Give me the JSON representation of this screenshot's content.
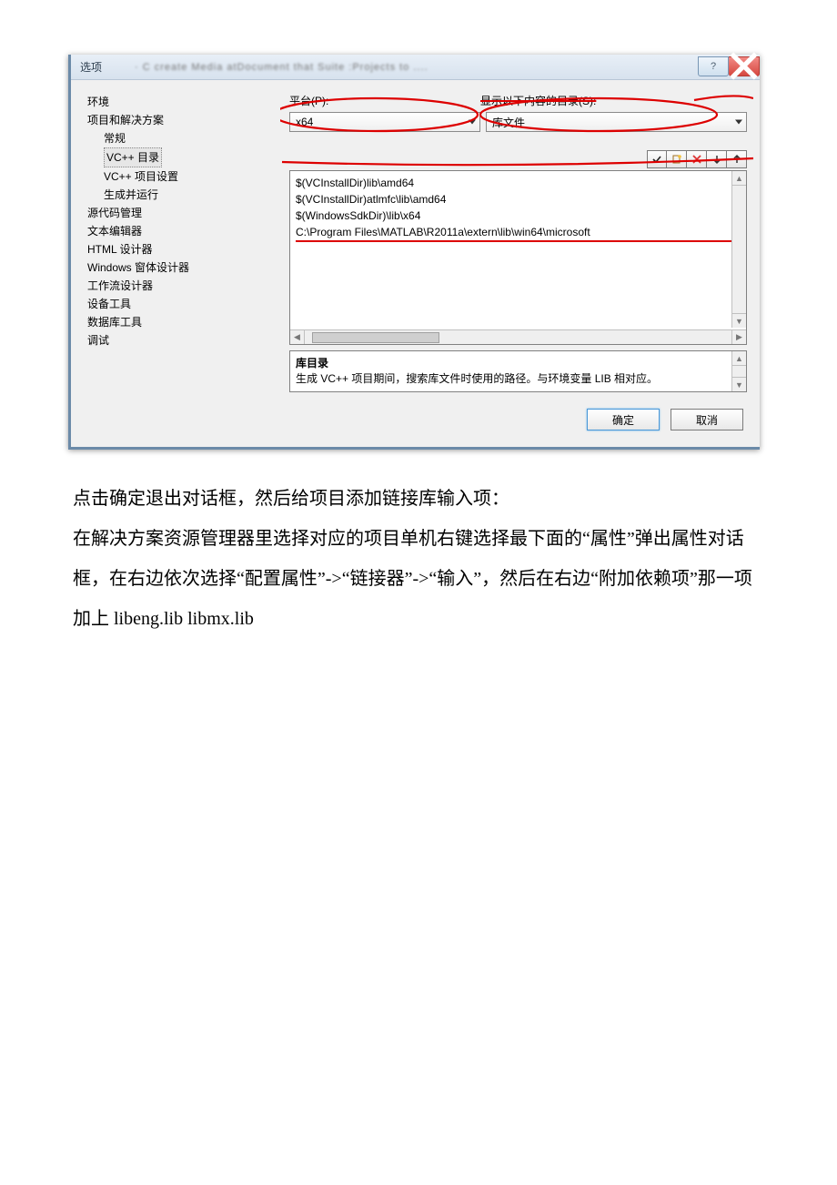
{
  "dialog": {
    "title": "选项",
    "help_aria": "帮助",
    "close_aria": "关闭"
  },
  "tree": {
    "items": [
      {
        "level": 0,
        "label": "环境",
        "selected": false
      },
      {
        "level": 0,
        "label": "项目和解决方案",
        "selected": false
      },
      {
        "level": 1,
        "label": "常规",
        "selected": false
      },
      {
        "level": 1,
        "label": "VC++ 目录",
        "selected": true
      },
      {
        "level": 1,
        "label": "VC++ 项目设置",
        "selected": false
      },
      {
        "level": 1,
        "label": "生成并运行",
        "selected": false
      },
      {
        "level": 0,
        "label": "源代码管理",
        "selected": false
      },
      {
        "level": 0,
        "label": "文本编辑器",
        "selected": false
      },
      {
        "level": 0,
        "label": "HTML 设计器",
        "selected": false
      },
      {
        "level": 0,
        "label": "Windows 窗体设计器",
        "selected": false
      },
      {
        "level": 0,
        "label": "工作流设计器",
        "selected": false
      },
      {
        "level": 0,
        "label": "设备工具",
        "selected": false
      },
      {
        "level": 0,
        "label": "数据库工具",
        "selected": false
      },
      {
        "level": 0,
        "label": "调试",
        "selected": false
      }
    ]
  },
  "right": {
    "platform_label": "平台(P):",
    "show_label": "显示以下内容的目录(S):",
    "platform_value": "x64",
    "show_value": "库文件",
    "toolbar": {
      "check_aria": "确认",
      "new_aria": "新建行",
      "delete_aria": "删除行",
      "down_aria": "下移",
      "up_aria": "上移"
    },
    "paths": [
      "$(VCInstallDir)lib\\amd64",
      "$(VCInstallDir)atlmfc\\lib\\amd64",
      "$(WindowsSdkDir)\\lib\\x64",
      "C:\\Program Files\\MATLAB\\R2011a\\extern\\lib\\win64\\microsoft"
    ],
    "desc_title": "库目录",
    "desc_body": "生成 VC++ 项目期间，搜索库文件时使用的路径。与环境变量 LIB 相对应。"
  },
  "buttons": {
    "ok": "确定",
    "cancel": "取消"
  },
  "article": {
    "p1": "点击确定退出对话框，然后给项目添加链接库输入项：",
    "p2": "在解决方案资源管理器里选择对应的项目单机右键选择最下面的“属性”弹出属性对话框，在右边依次选择“配置属性”->“链接器”->“输入”，然后在右边“附加依赖项”那一项加上 libeng.lib libmx.lib"
  }
}
